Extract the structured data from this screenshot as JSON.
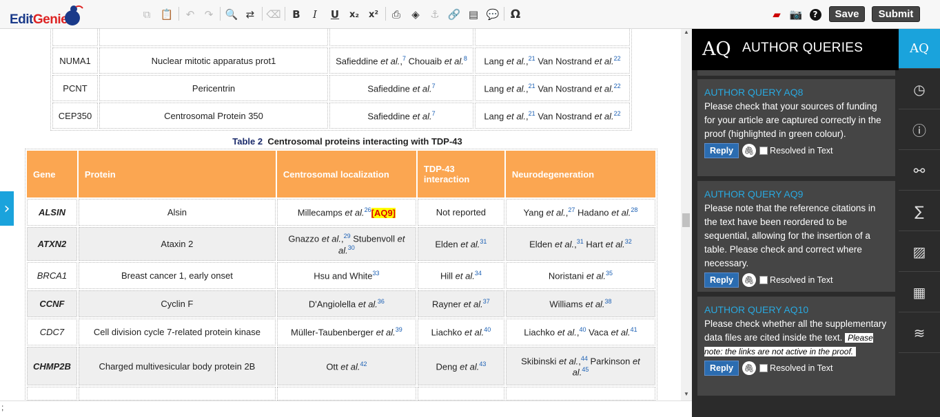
{
  "app": {
    "logo_a": "Edit",
    "logo_b": "Genie"
  },
  "toolbar": {
    "save": "Save",
    "submit": "Submit",
    "icons": [
      "copy-icon",
      "paste-icon",
      "undo-icon",
      "redo-icon",
      "search-icon",
      "replace-icon",
      "eraser-icon",
      "bold-icon",
      "italic-icon",
      "underline-icon",
      "subscript-icon",
      "superscript-icon",
      "print-icon",
      "layers-icon",
      "anchor-icon",
      "link-icon",
      "note-icon",
      "comment-icon",
      "omega-icon",
      "pdf-icon",
      "camera-icon",
      "help-icon"
    ],
    "glyphs": {
      "bold": "B",
      "italic": "I",
      "underline": "U",
      "subscript": "x₂",
      "superscript": "x²",
      "omega": "Ω",
      "help": "?"
    }
  },
  "table1": {
    "rows": [
      {
        "gene": "NUMA1",
        "protein": "Nuclear mitotic apparatus prot1",
        "loc_a": "Safieddine",
        "loc_a_ref": "7",
        "loc_b": "Chouaib",
        "loc_b_ref": "8",
        "neuro_a": "Lang",
        "neuro_a_ref": "21",
        "neuro_b": "Van Nostrand",
        "neuro_b_ref": "22"
      },
      {
        "gene": "PCNT",
        "protein": "Pericentrin",
        "loc_a": "Safieddine",
        "loc_a_ref": "7",
        "neuro_a": "Lang",
        "neuro_a_ref": "21",
        "neuro_b": "Van Nostrand",
        "neuro_b_ref": "22"
      },
      {
        "gene": "CEP350",
        "protein": "Centrosomal Protein 350",
        "loc_a": "Safieddine",
        "loc_a_ref": "7",
        "neuro_a": "Lang",
        "neuro_a_ref": "21",
        "neuro_b": "Van Nostrand",
        "neuro_b_ref": "22"
      }
    ]
  },
  "etal": "et al.",
  "table2": {
    "caption_label": "Table 2",
    "caption": "Centrosomal proteins interacting with TDP-43",
    "headers": [
      "Gene",
      "Protein",
      "Centrosomal localization",
      "TDP-43 interaction",
      "Neurodegeneration"
    ],
    "rows": [
      {
        "gene": "ALSIN",
        "protein": "Alsin",
        "loc": "Millecamps",
        "loc_ref": "26",
        "aq": "[AQ9]",
        "tdp": "Not reported",
        "neu_a": "Yang",
        "neu_a_ref": "27",
        "neu_b": "Hadano",
        "neu_b_ref": "28"
      },
      {
        "gene": "ATXN2",
        "protein": "Ataxin 2",
        "loc": "Gnazzo",
        "loc_ref": "29",
        "loc2": "Stubenvoll",
        "loc2_ref": "30",
        "tdp": "Elden",
        "tdp_ref": "31",
        "neu_a": "Elden",
        "neu_a_ref": "31",
        "neu_b": "Hart",
        "neu_b_ref": "32"
      },
      {
        "gene": "BRCA1",
        "protein": "Breast cancer 1, early onset",
        "loc": "Hsu and White",
        "loc_ref": "33",
        "tdp": "Hill",
        "tdp_ref": "34",
        "neu_a": "Noristani",
        "neu_a_ref": "35"
      },
      {
        "gene": "CCNF",
        "protein": "Cyclin F",
        "loc": "D'Angiolella",
        "loc_ref": "36",
        "tdp": "Rayner",
        "tdp_ref": "37",
        "neu_a": "Williams",
        "neu_a_ref": "38"
      },
      {
        "gene": "CDC7",
        "protein": "Cell division cycle 7-related protein kinase",
        "loc": "Müller-Taubenberger",
        "loc_ref": "39",
        "tdp": "Liachko",
        "tdp_ref": "40",
        "neu_a": "Liachko",
        "neu_a_ref": "40",
        "neu_b": "Vaca",
        "neu_b_ref": "41"
      },
      {
        "gene": "CHMP2B",
        "protein": "Charged multivesicular body protein 2B",
        "loc": "Ott",
        "loc_ref": "42",
        "tdp": "Deng",
        "tdp_ref": "43",
        "neu_a": "Skibinski",
        "neu_a_ref": "44",
        "neu_b": "Parkinson",
        "neu_b_ref": "45"
      }
    ]
  },
  "panel": {
    "big": "AQ",
    "title": "AUTHOR QUERIES",
    "reply": "Reply",
    "resolved": "Resolved in Text",
    "queries": [
      {
        "head": "AUTHOR QUERY  AQ8",
        "body": "Please check that your sources of funding for your article are captured correctly in the proof (highlighted in green colour)."
      },
      {
        "head": "AUTHOR QUERY  AQ9",
        "body": "Please note that the reference citations in the text have been reordered to be sequential, allowing for the insertion of a table. Please check and correct where necessary."
      },
      {
        "head": "AUTHOR QUERY  AQ10",
        "body": "Please check whether all the supplementary data files are cited inside the text.",
        "note": "Please note: the links are not active in the proof."
      }
    ]
  },
  "rail": {
    "active": "AQ",
    "icons": [
      "aq-icon",
      "history-icon",
      "info-icon",
      "link-icon",
      "sigma-icon",
      "image-icon",
      "table-icon",
      "stack-icon"
    ]
  },
  "statusbar": {
    "text": ";"
  }
}
